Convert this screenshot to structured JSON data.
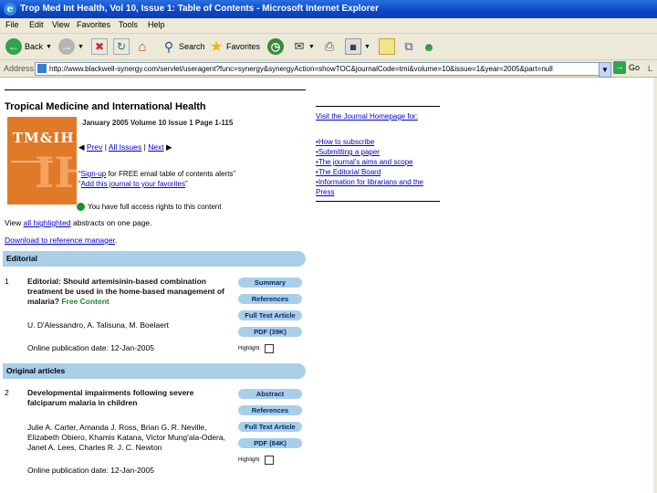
{
  "window": {
    "title": "Trop Med Int Health, Vol 10, Issue 1: Table of Contents - Microsoft Internet Explorer"
  },
  "menu": [
    "File",
    "Edit",
    "View",
    "Favorites",
    "Tools",
    "Help"
  ],
  "toolbar": {
    "back_label": "Back",
    "search_label": "Search",
    "favorites_label": "Favorites"
  },
  "address": {
    "label": "Address",
    "url": "http://www.blackwell-synergy.com/servlet/useragent?func=synergy&synergyAction=showTOC&journalCode=tmi&volume=10&issue=1&year=2005&part=null",
    "go_label": "Go",
    "links_label": "L"
  },
  "journal": {
    "title": "Tropical Medicine and International Health",
    "cover_text": "TM&IH",
    "issue_line": "January 2005   Volume 10 Issue 1 Page 1-115",
    "nav": {
      "prev": "Prev",
      "all_issues": "All Issues",
      "next": "Next"
    },
    "signup_link": "Sign-up",
    "signup_rest": " for FREE email table of contents alerts",
    "add_link": "Add this journal to your favorites",
    "access_text": "You have full access rights to this content",
    "view_prefix": "View ",
    "view_link": "all highlighted",
    "view_suffix": " abstracts on one page.",
    "download_link": "Download to reference manager",
    "download_suffix": "."
  },
  "sections": [
    {
      "heading": "Editorial",
      "articles": [
        {
          "number": "1",
          "title": "Editorial: Should artemisinin-based combination treatment be used in the home-based management of malaria?",
          "free_label": "Free Content",
          "authors": "U. D'Alessandro, A. Talisuna, M. Boelaert",
          "pub_date": "Online publication date: 12-Jan-2005",
          "highlight_label": "Highlight",
          "buttons": [
            "Summary",
            "References",
            "Full Text Article",
            "PDF (39K)"
          ]
        }
      ]
    },
    {
      "heading": "Original articles",
      "articles": [
        {
          "number": "2",
          "title": "Developmental impairments following severe falciparum malaria in children",
          "authors": "Julie A. Carter, Amanda J. Ross, Brian G. R. Neville, Elizabeth Obiero, Khamis Katana, Victor Mung'ala-Odera, Janet A. Lees, Charles R. J. C. Newton",
          "pub_date": "Online publication date: 12-Jan-2005",
          "highlight_label": "Highlight",
          "buttons": [
            "Abstract",
            "References",
            "Full Text Article",
            "PDF (84K)"
          ]
        }
      ]
    }
  ],
  "sidebar": {
    "visit": "Visit the Journal Homepage for:",
    "items": [
      "How to subscribe",
      "Submitting a paper",
      "The journal's aims and scope",
      "The Editorial Board",
      "Information for librarians and the Press"
    ]
  }
}
